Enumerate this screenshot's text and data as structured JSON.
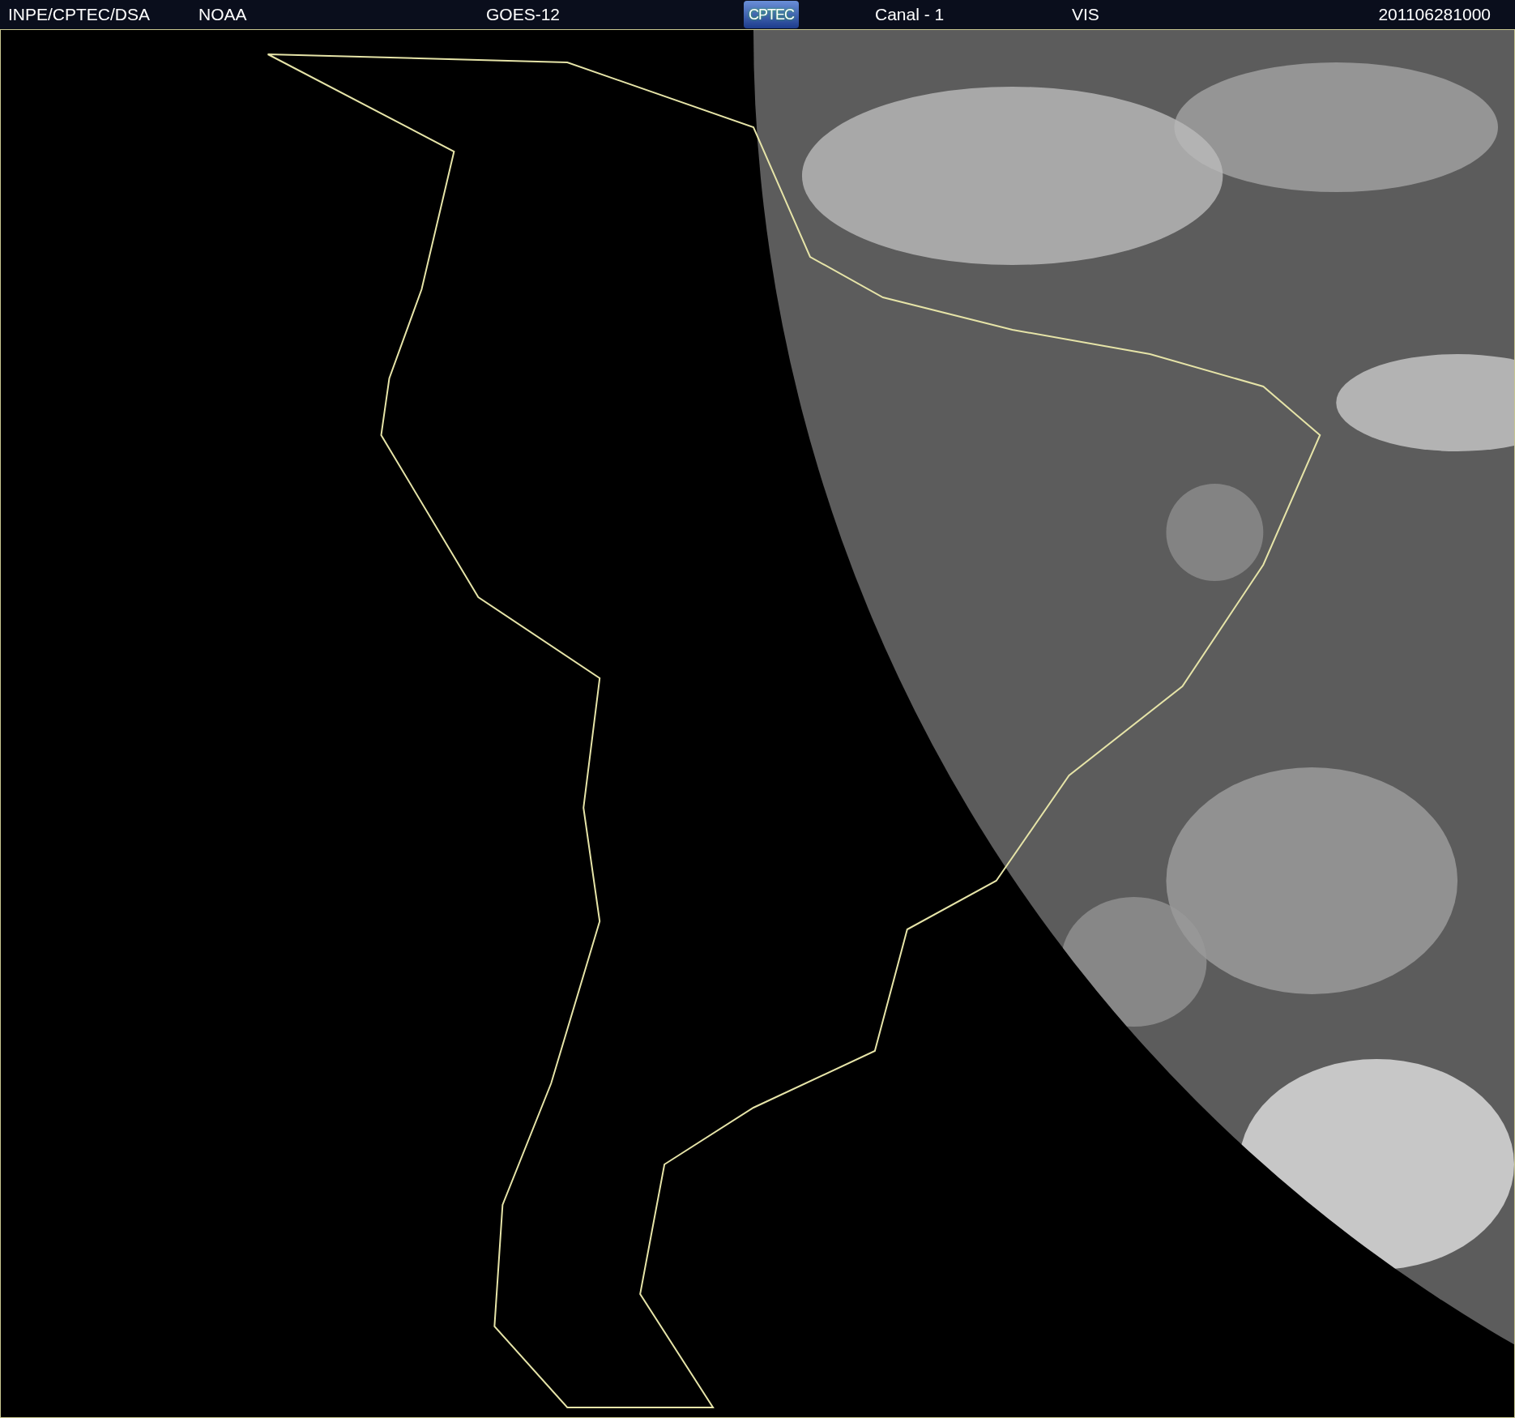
{
  "header": {
    "items": [
      {
        "kind": "text",
        "text": "INPE/CPTEC/DSA"
      },
      {
        "kind": "text",
        "text": "NOAA"
      },
      {
        "kind": "text",
        "text": "GOES-12"
      },
      {
        "kind": "logo",
        "text": "CPTEC"
      },
      {
        "kind": "text",
        "text": "Canal - 1"
      },
      {
        "kind": "text",
        "text": "VIS"
      },
      {
        "kind": "date",
        "text": "201106281000"
      }
    ]
  }
}
